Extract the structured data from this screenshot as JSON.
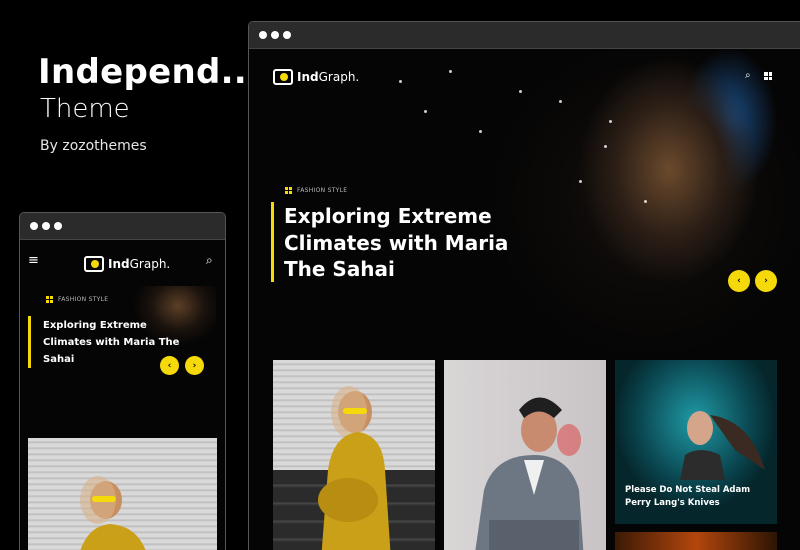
{
  "product": {
    "title": "Independ..",
    "subtitle": "Theme",
    "author": "By zozothemes"
  },
  "site": {
    "logo_strong": "Ind",
    "logo_thin": "Graph."
  },
  "desktop": {
    "hero": {
      "category": "FASHION STYLE",
      "title_lines": [
        "Exploring Extreme",
        "Climates with Maria",
        "The Sahai"
      ]
    },
    "cards": [
      {
        "caption": ""
      },
      {
        "caption": ""
      },
      {
        "caption_lines": [
          "Please Do Not Steal Adam",
          "Perry Lang's Knives"
        ]
      }
    ]
  },
  "mobile": {
    "hero": {
      "category": "FASHION STYLE",
      "title_lines": [
        "Exploring Extreme",
        "Climates with Maria The",
        "Sahai"
      ]
    }
  },
  "icons": {
    "prev": "‹",
    "next": "›",
    "search": "⌕",
    "menu": "≡"
  },
  "colors": {
    "accent": "#f5d90a",
    "background": "#000000"
  }
}
